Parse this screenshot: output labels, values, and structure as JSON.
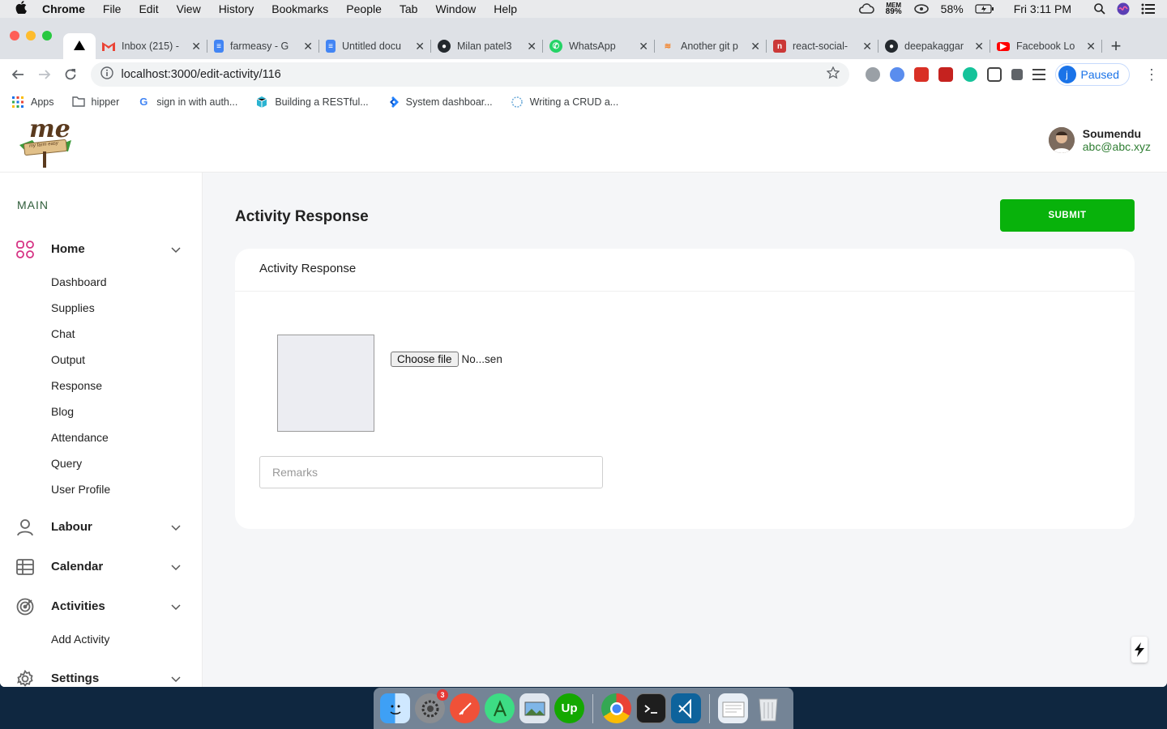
{
  "os_menubar": {
    "app_name": "Chrome",
    "menus": [
      "File",
      "Edit",
      "View",
      "History",
      "Bookmarks",
      "People",
      "Tab",
      "Window",
      "Help"
    ],
    "mem_label": "MEM",
    "mem_value": "89%",
    "battery": "58%",
    "clock": "Fri 3:11 PM"
  },
  "browser": {
    "tabs": [
      {
        "title": "Inbox (215) -",
        "icon": "gmail-icon",
        "color": "#ea4335"
      },
      {
        "title": "farmeasy - G",
        "icon": "docs-icon",
        "color": "#4285f4"
      },
      {
        "title": "Untitled docu",
        "icon": "docs-icon",
        "color": "#4285f4"
      },
      {
        "title": "Milan patel3",
        "icon": "github-icon",
        "color": "#24292e"
      },
      {
        "title": "WhatsApp",
        "icon": "whatsapp-icon",
        "color": "#25d366"
      },
      {
        "title": "Another git p",
        "icon": "stackoverflow-icon",
        "color": "#f48024"
      },
      {
        "title": "react-social-",
        "icon": "npm-icon",
        "color": "#cb3837"
      },
      {
        "title": "deepakaggar",
        "icon": "github-icon",
        "color": "#24292e"
      },
      {
        "title": "Facebook Lo",
        "icon": "youtube-icon",
        "color": "#ff0000"
      }
    ],
    "url": "localhost:3000/edit-activity/116",
    "profile_label": "Paused",
    "profile_initial": "j",
    "bookmarks": [
      {
        "label": "Apps",
        "icon": "apps-grid-icon"
      },
      {
        "label": "hipper",
        "icon": "folder-icon"
      },
      {
        "label": "sign in with auth...",
        "icon": "google-icon"
      },
      {
        "label": "Building a RESTful...",
        "icon": "cube-icon"
      },
      {
        "label": "System dashboar...",
        "icon": "jira-icon"
      },
      {
        "label": "Writing a CRUD a...",
        "icon": "site-icon"
      }
    ]
  },
  "app": {
    "logo_text": "my farm easy",
    "user": {
      "name": "Soumendu",
      "email": "abc@abc.xyz"
    },
    "sidebar": {
      "section_title": "MAIN",
      "groups": [
        {
          "label": "Home",
          "icon": "grid-icon",
          "items": [
            "Dashboard",
            "Supplies",
            "Chat",
            "Output",
            "Response",
            "Blog",
            "Attendance",
            "Query",
            "User Profile"
          ]
        },
        {
          "label": "Labour",
          "icon": "user-icon",
          "items": []
        },
        {
          "label": "Calendar",
          "icon": "table-icon",
          "items": []
        },
        {
          "label": "Activities",
          "icon": "target-icon",
          "items": [
            "Add Activity"
          ]
        },
        {
          "label": "Settings",
          "icon": "gear-icon",
          "items": []
        }
      ]
    },
    "main": {
      "page_title": "Activity Response",
      "submit_label": "SUBMIT",
      "card_title": "Activity Response",
      "file_button_label": "Choose file",
      "file_status": "No...sen",
      "remarks_placeholder": "Remarks",
      "remarks_value": ""
    },
    "colors": {
      "accent_green": "#08b20b",
      "icon_pink": "#d63384"
    }
  },
  "dock": {
    "settings_badge": "3"
  }
}
